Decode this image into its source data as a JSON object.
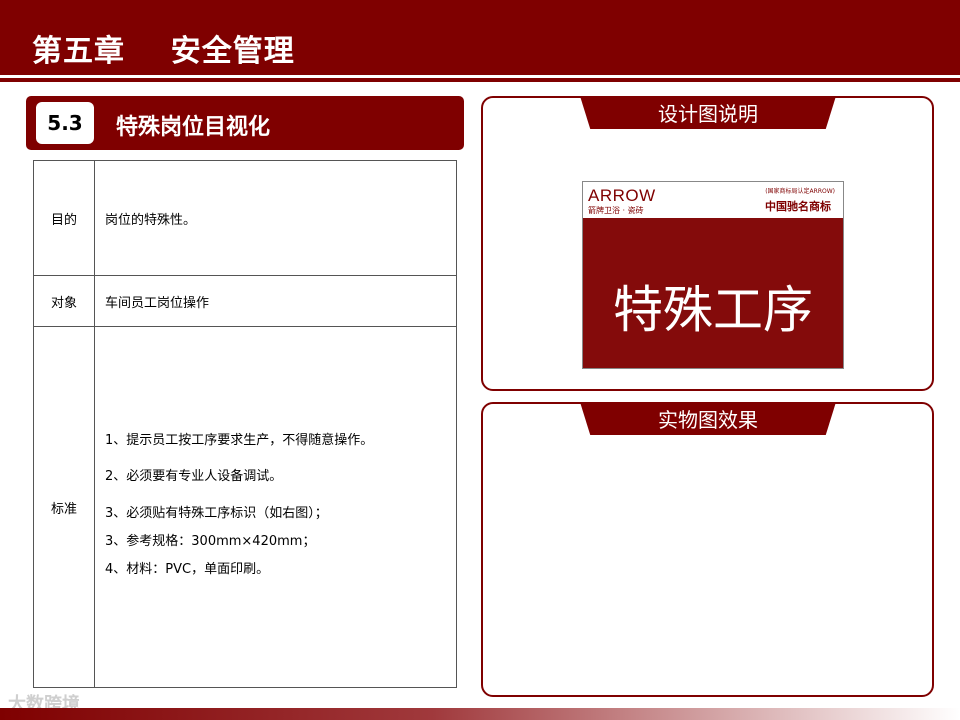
{
  "header": {
    "title": "第五章    安全管理"
  },
  "section": {
    "number": "5.3",
    "title": "特殊岗位目视化"
  },
  "table": {
    "rows": [
      {
        "label": "目的",
        "value": "岗位的特殊性。"
      },
      {
        "label": "对象",
        "value": "车间员工岗位操作"
      },
      {
        "label": "标准",
        "lines": [
          "1、提示员工按工序要求生产，不得随意操作。",
          "2、必须要有专业人设备调试。",
          "3、必须贴有特殊工序标识（如右图）；",
          "3、参考规格：300mm×420mm；",
          "4、材料：PVC，单面印刷。"
        ]
      }
    ]
  },
  "panels": {
    "design": {
      "title": "设计图说明",
      "sign": {
        "brand": "ARROW",
        "brand_sub": "箭牌卫浴 · 瓷砖",
        "cert": "(国家商标局认定ARROW)",
        "mark": "中国驰名商标",
        "text": "特殊工序"
      }
    },
    "actual": {
      "title": "实物图效果"
    }
  },
  "watermark": "大数跨境",
  "colors": {
    "primary": "#7f0000"
  }
}
